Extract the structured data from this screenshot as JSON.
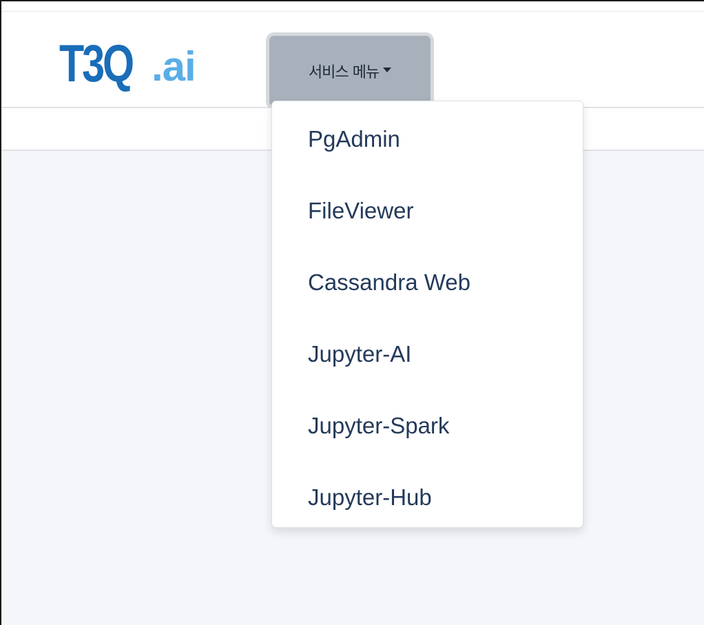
{
  "logo": {
    "main": "T3Q",
    "suffix": ".ai",
    "color_main": "#1a6db8",
    "color_suffix": "#5aaee6"
  },
  "nav": {
    "menu_label": "서비스 메뉴",
    "menu_icon": "caret-down-icon"
  },
  "dropdown": {
    "items": [
      {
        "label": "PgAdmin"
      },
      {
        "label": "FileViewer"
      },
      {
        "label": "Cassandra Web"
      },
      {
        "label": "Jupyter-AI"
      },
      {
        "label": "Jupyter-Spark"
      },
      {
        "label": "Jupyter-Hub"
      }
    ]
  },
  "colors": {
    "toggle_bg": "#a8b1bb",
    "item_text": "#243a5a",
    "content_bg": "#f4f6fa"
  }
}
